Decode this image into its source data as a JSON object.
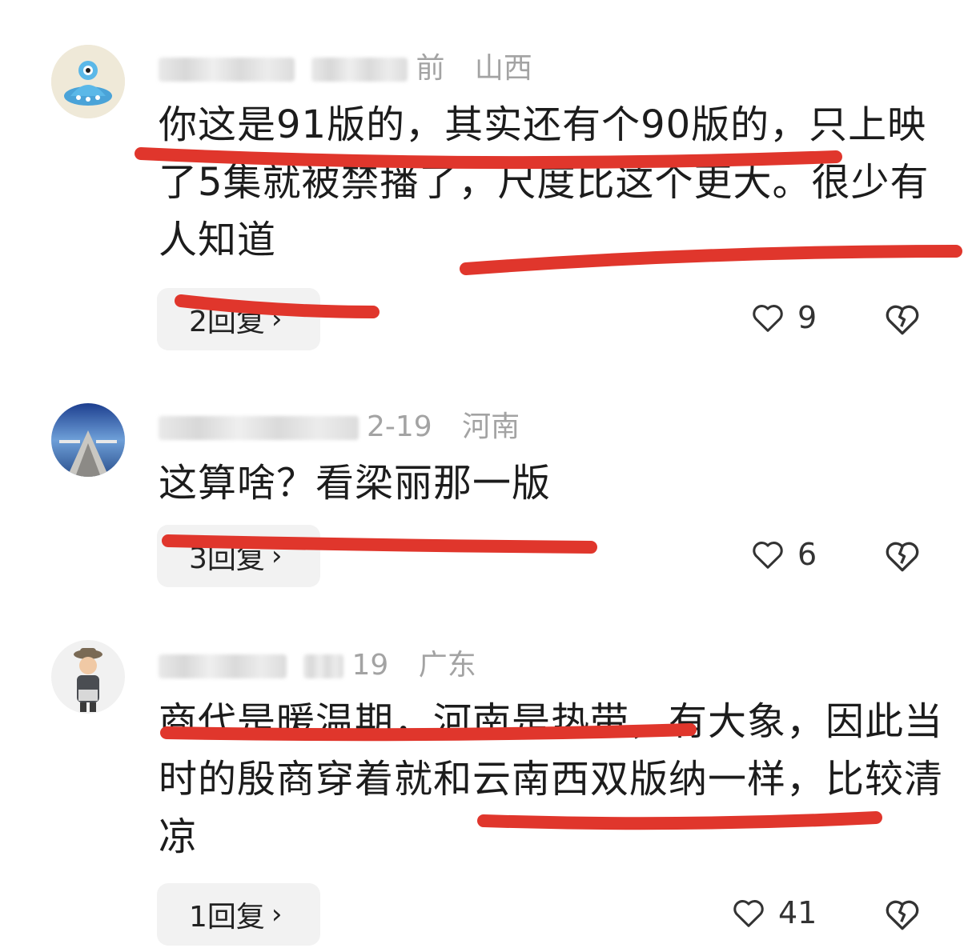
{
  "comments": [
    {
      "meta_tail": "前",
      "location": "山西",
      "text": "你这是91版的，其实还有个90版的，只上映了5集就被禁播了，尺度比这个更大。很少有人知道",
      "reply_label": "2回复",
      "like_count": "9"
    },
    {
      "date": "2-19",
      "location": "河南",
      "text": "这算啥？看梁丽那一版",
      "reply_label": "3回复",
      "like_count": "6"
    },
    {
      "date": "19",
      "location": "广东",
      "text": "商代是暖温期，河南是热带，有大象，因此当时的殷商穿着就和云南西双版纳一样，比较清凉",
      "reply_label": "1回复",
      "like_count": "41"
    }
  ],
  "icons": {
    "like": "heart-outline-icon",
    "dislike": "broken-heart-icon",
    "reply_chevron": "chevron-right-icon"
  },
  "colors": {
    "annotation_red": "#e0362c",
    "meta_gray": "#a3a3a3",
    "reply_bg": "#f2f2f2"
  }
}
